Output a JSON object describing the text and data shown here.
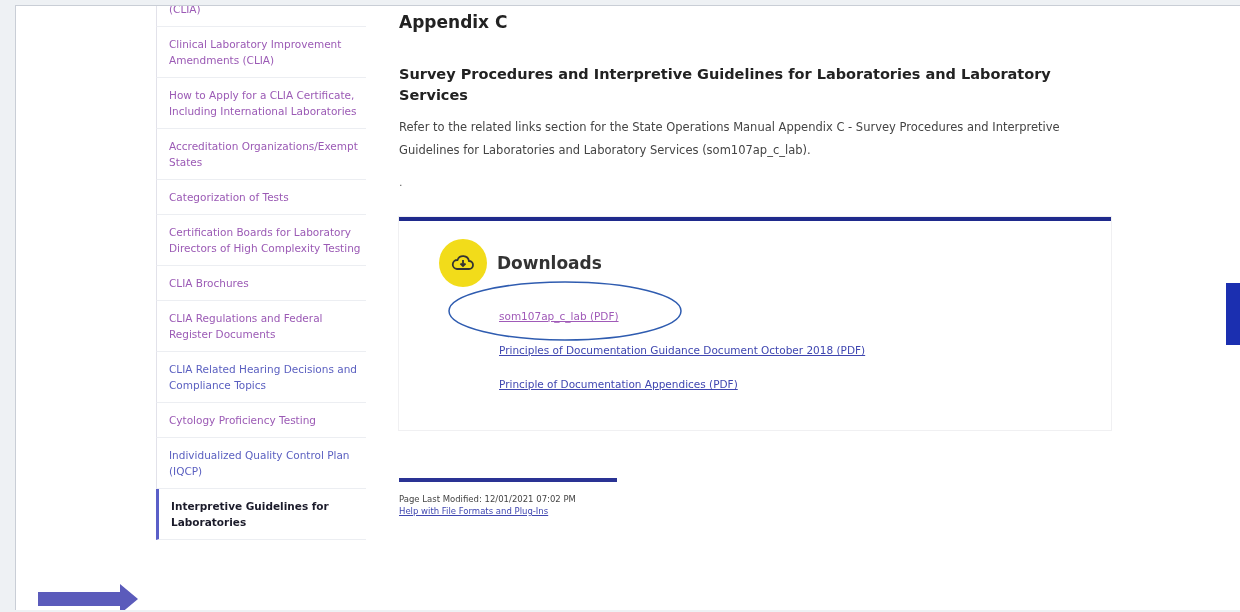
{
  "sidebar": {
    "items": [
      {
        "label": "(CLIA)",
        "visited": true,
        "selected": false
      },
      {
        "label": "Clinical Laboratory Improvement Amendments (CLIA)",
        "visited": true,
        "selected": false
      },
      {
        "label": "How to Apply for a CLIA Certificate, Including International Laboratories",
        "visited": true,
        "selected": false
      },
      {
        "label": "Accreditation Organizations/Exempt States",
        "visited": true,
        "selected": false
      },
      {
        "label": "Categorization of Tests",
        "visited": true,
        "selected": false
      },
      {
        "label": "Certification Boards for Laboratory Directors of High Complexity Testing",
        "visited": true,
        "selected": false
      },
      {
        "label": "CLIA Brochures",
        "visited": true,
        "selected": false
      },
      {
        "label": "CLIA Regulations and Federal Register Documents",
        "visited": true,
        "selected": false
      },
      {
        "label": "CLIA Related Hearing Decisions and Compliance Topics",
        "visited": false,
        "selected": false
      },
      {
        "label": "Cytology Proficiency Testing",
        "visited": true,
        "selected": false
      },
      {
        "label": "Individualized Quality Control Plan (IQCP)",
        "visited": false,
        "selected": false
      },
      {
        "label": "Interpretive Guidelines for Laboratories",
        "visited": false,
        "selected": true
      }
    ]
  },
  "main": {
    "title": "Appendix C",
    "subtitle": "Survey Procedures and Interpretive Guidelines for Laboratories and Laboratory Services",
    "body": "Refer to the related links section for the State Operations Manual Appendix C - Survey Procedures and Interpretive Guidelines for Laboratories and Laboratory Services (som107ap_c_lab).",
    "dot": "."
  },
  "downloads": {
    "title": "Downloads",
    "links": [
      {
        "label": "som107ap_c_lab (PDF)",
        "visited": true,
        "circled": true
      },
      {
        "label": "Principles of Documentation Guidance Document October 2018 (PDF)",
        "visited": false,
        "circled": false
      },
      {
        "label": "Principle of Documentation Appendices (PDF)",
        "visited": false,
        "circled": false
      }
    ]
  },
  "footer": {
    "modified_label": "Page Last Modified:",
    "modified_value": "12/01/2021 07:02 PM",
    "help_link": "Help with File Formats and Plug-Ins"
  },
  "annotation": {
    "arrow": true
  }
}
